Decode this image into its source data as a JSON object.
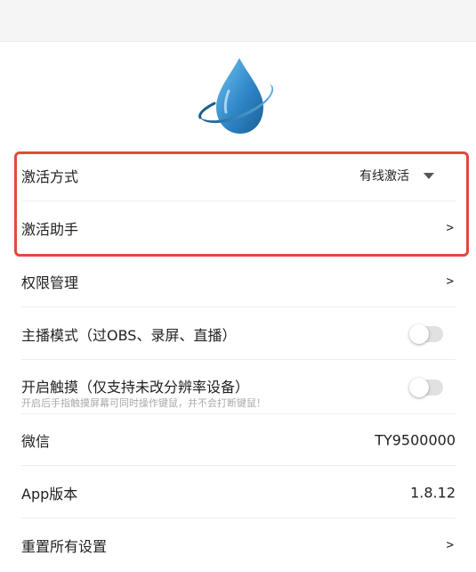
{
  "settings": {
    "activation_mode": {
      "label": "激活方式",
      "value": "有线激活"
    },
    "activation_assistant": {
      "label": "激活助手",
      "chevron": ">"
    },
    "permissions": {
      "label": "权限管理",
      "chevron": ">"
    },
    "streamer_mode": {
      "label": "主播模式（过OBS、录屏、直播）",
      "enabled": false
    },
    "touch": {
      "label": "开启触摸（仅支持未改分辨率设备）",
      "description": "开启后手指触摸屏幕可同时操作键鼠，并不会打断键鼠！",
      "enabled": false
    },
    "wechat": {
      "label": "微信",
      "value": "TY9500000"
    },
    "app_version": {
      "label": "App版本",
      "value": "1.8.12"
    },
    "reset": {
      "label": "重置所有设置",
      "chevron": ">"
    }
  },
  "colors": {
    "highlight_border": "#e04a3a",
    "logo_blue": "#3a8fd0",
    "toggle_off": "#e1e1e1"
  },
  "icons": {
    "logo": "water-drop-planet-icon",
    "dropdown": "caret-down-icon",
    "chevron": "chevron-right-icon"
  }
}
